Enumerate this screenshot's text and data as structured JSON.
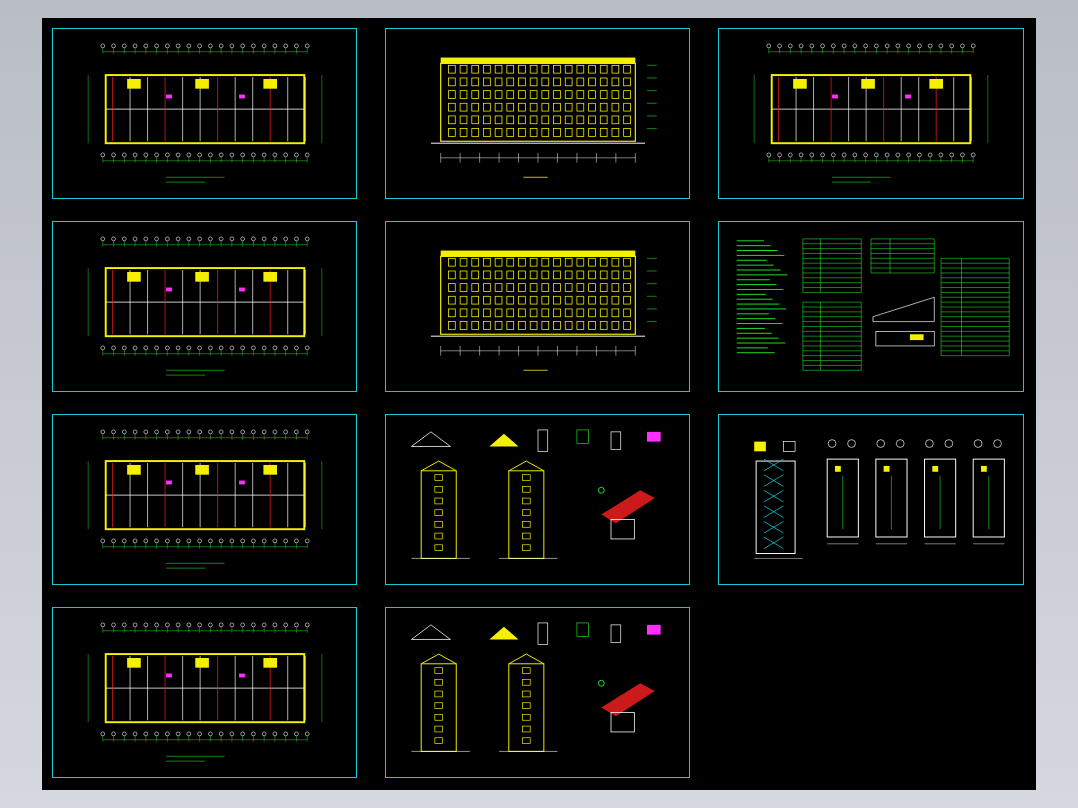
{
  "columns": [
    {
      "sheets": [
        {
          "kind": "plan"
        },
        {
          "kind": "plan"
        },
        {
          "kind": "plan"
        },
        {
          "kind": "plan"
        }
      ]
    },
    {
      "sheets": [
        {
          "kind": "elevation"
        },
        {
          "kind": "elevation"
        },
        {
          "kind": "section"
        },
        {
          "kind": "section"
        }
      ]
    },
    {
      "sheets": [
        {
          "kind": "plan"
        },
        {
          "kind": "notes"
        },
        {
          "kind": "stair"
        }
      ]
    }
  ]
}
